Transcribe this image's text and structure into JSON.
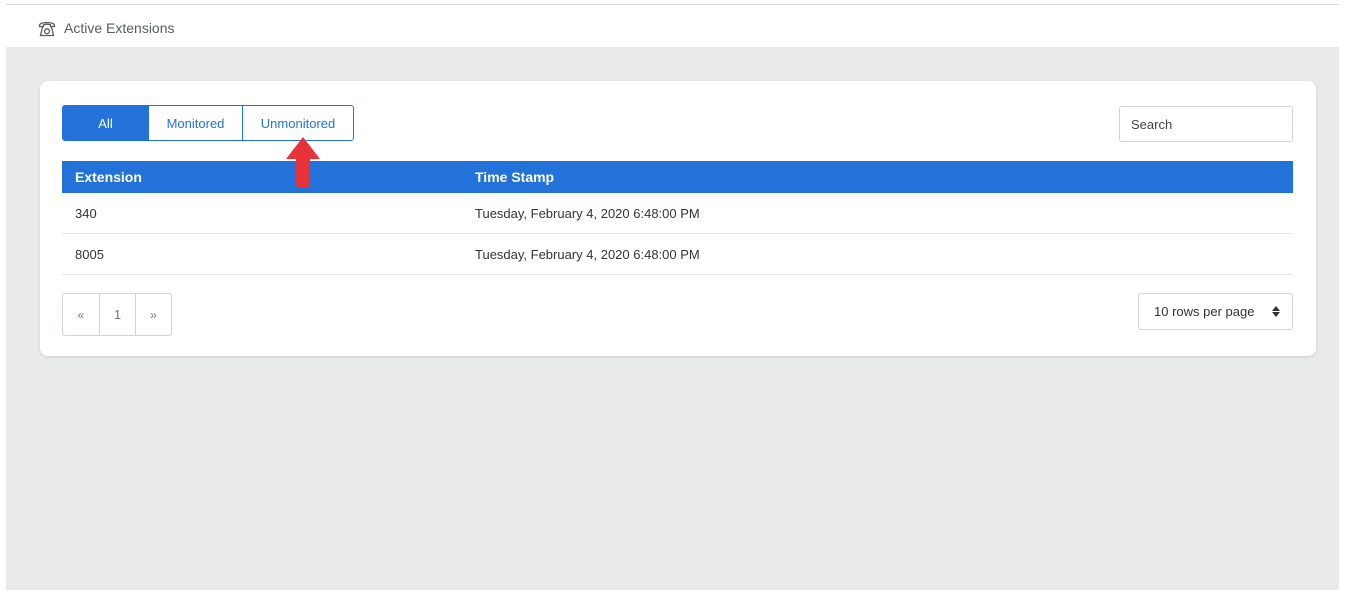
{
  "page": {
    "title": "Active Extensions",
    "title_icon": "phone-icon"
  },
  "filters": {
    "tabs": [
      {
        "label": "All",
        "active": true
      },
      {
        "label": "Monitored",
        "active": false
      },
      {
        "label": "Unmonitored",
        "active": false
      }
    ]
  },
  "search": {
    "placeholder": "Search",
    "value": ""
  },
  "table": {
    "columns": [
      "Extension",
      "Time Stamp"
    ],
    "rows": [
      [
        "340",
        "Tuesday, February 4, 2020 6:48:00 PM"
      ],
      [
        "8005",
        "Tuesday, February 4, 2020 6:48:00 PM"
      ]
    ]
  },
  "pagination": {
    "prev": "«",
    "page": "1",
    "next": "»"
  },
  "rows_per_page": {
    "selected": "10 rows per page"
  },
  "colors": {
    "accent": "#2272d9",
    "annotation_arrow": "#e8323a",
    "background": "#e9eaec"
  }
}
